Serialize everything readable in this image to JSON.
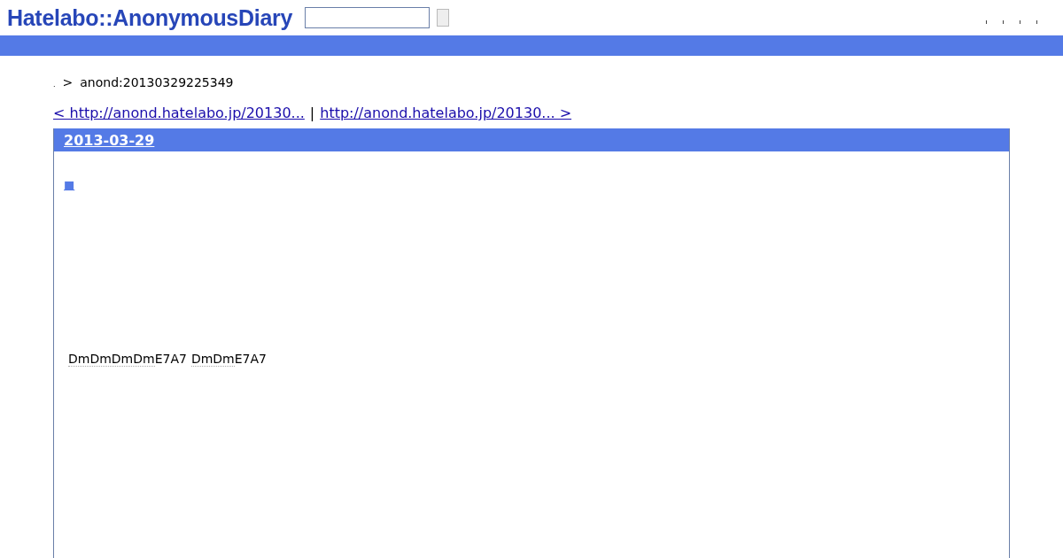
{
  "header": {
    "logo": "Hatelabo::AnonymousDiary"
  },
  "breadcrumb": {
    "separator_mark": ".",
    "arrow": ">",
    "current": "anond:20130329225349"
  },
  "pager": {
    "prev": "< http://anond.hatelabo.jp/20130...",
    "divider": "|",
    "next": "http://anond.hatelabo.jp/20130... >"
  },
  "day": {
    "date": "2013-03-29",
    "section_mark": "■",
    "body": [
      {
        "text": "DmDmDmDm",
        "keyword": true
      },
      {
        "text": "E7A7",
        "keyword": false
      },
      {
        "text": "DmDm",
        "keyword": true
      },
      {
        "text": "E7A7",
        "keyword": false
      }
    ]
  }
}
